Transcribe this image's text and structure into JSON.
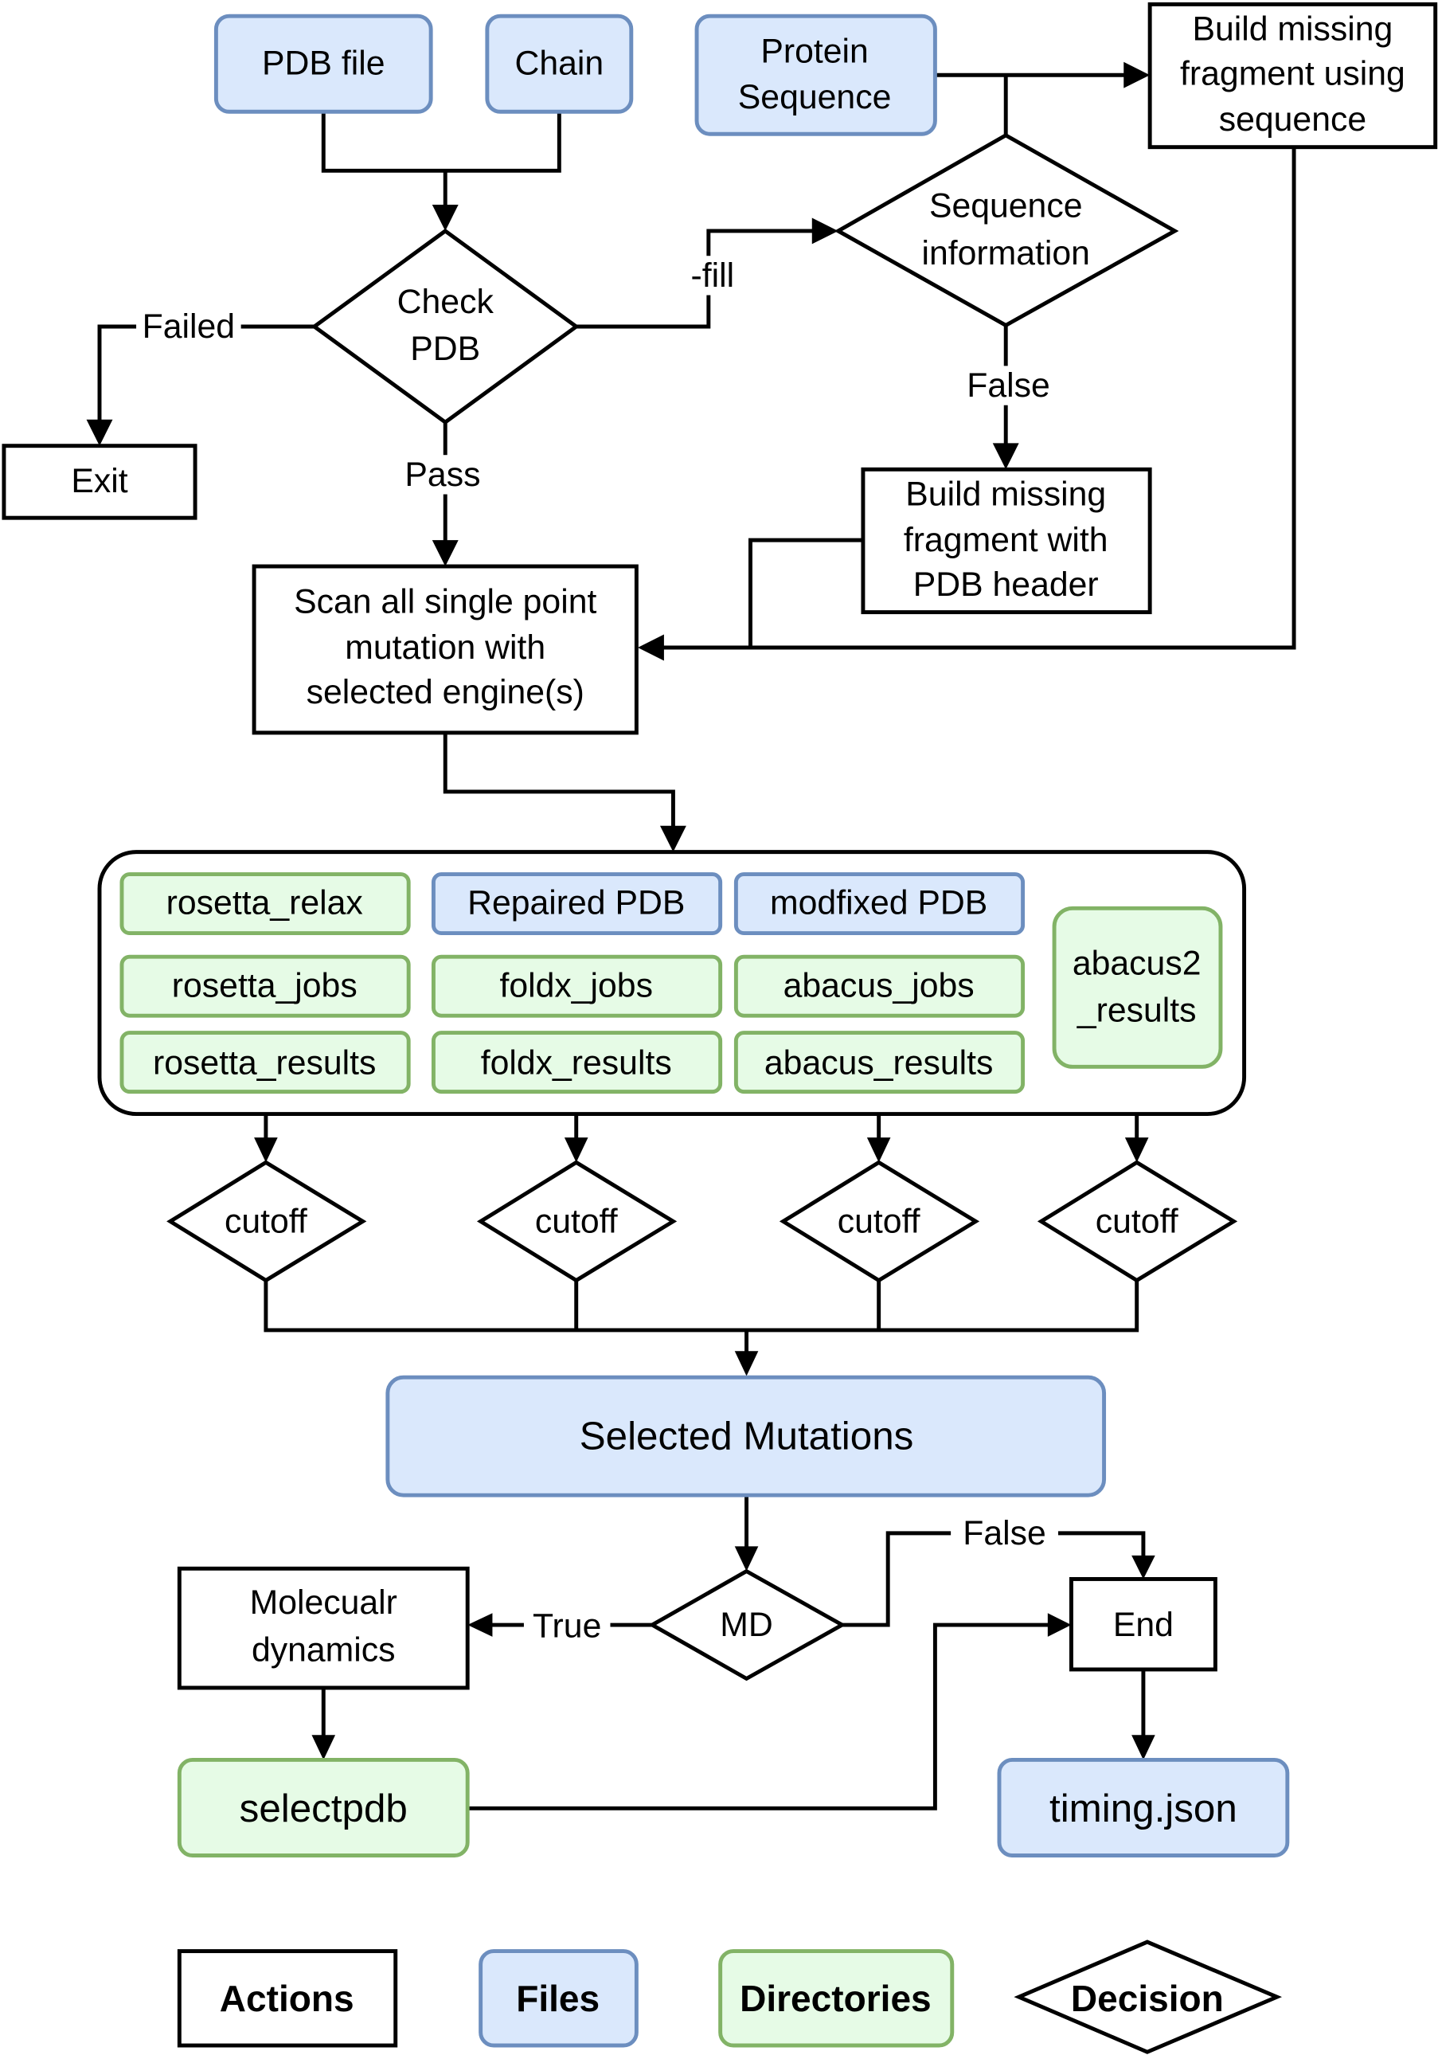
{
  "nodes": {
    "pdb_file": "PDB file",
    "chain": "Chain",
    "protein_sequence": [
      "Protein",
      "Sequence"
    ],
    "build_using_sequence": [
      "Build missing",
      "fragment using",
      "sequence"
    ],
    "check_pdb": [
      "Check",
      "PDB"
    ],
    "sequence_information": [
      "Sequence",
      "information"
    ],
    "exit": "Exit",
    "build_with_header": [
      "Build missing",
      "fragment with",
      "PDB header"
    ],
    "scan": [
      "Scan all single point",
      "mutation with",
      "selected engine(s)"
    ],
    "selected_mutations": "Selected Mutations",
    "md": "MD",
    "molecular_dynamics": [
      "Molecualr",
      "dynamics"
    ],
    "end": "End",
    "selectpdb": "selectpdb",
    "timing_json": "timing.json"
  },
  "outputs_group": {
    "rosetta_relax": "rosetta_relax",
    "repaired_pdb": "Repaired PDB",
    "modfixed_pdb": "modfixed PDB",
    "rosetta_jobs": "rosetta_jobs",
    "foldx_jobs": "foldx_jobs",
    "abacus_jobs": "abacus_jobs",
    "rosetta_results": "rosetta_results",
    "foldx_results": "foldx_results",
    "abacus_results": "abacus_results",
    "abacus2_results": [
      "abacus2",
      "_results"
    ]
  },
  "cutoffs": [
    "cutoff",
    "cutoff",
    "cutoff",
    "cutoff"
  ],
  "edge_labels": {
    "failed": "Failed",
    "fill": "-fill",
    "pass": "Pass",
    "seq_false": "False",
    "md_true": "True",
    "md_false": "False"
  },
  "legend": {
    "actions": "Actions",
    "files": "Files",
    "directories": "Directories",
    "decision": "Decision"
  },
  "colors": {
    "file_fill": "#dae8fc",
    "file_stroke": "#6c8ebf",
    "dir_fill": "#e6fbe6",
    "dir_stroke": "#82b366",
    "action_stroke": "#000000"
  }
}
